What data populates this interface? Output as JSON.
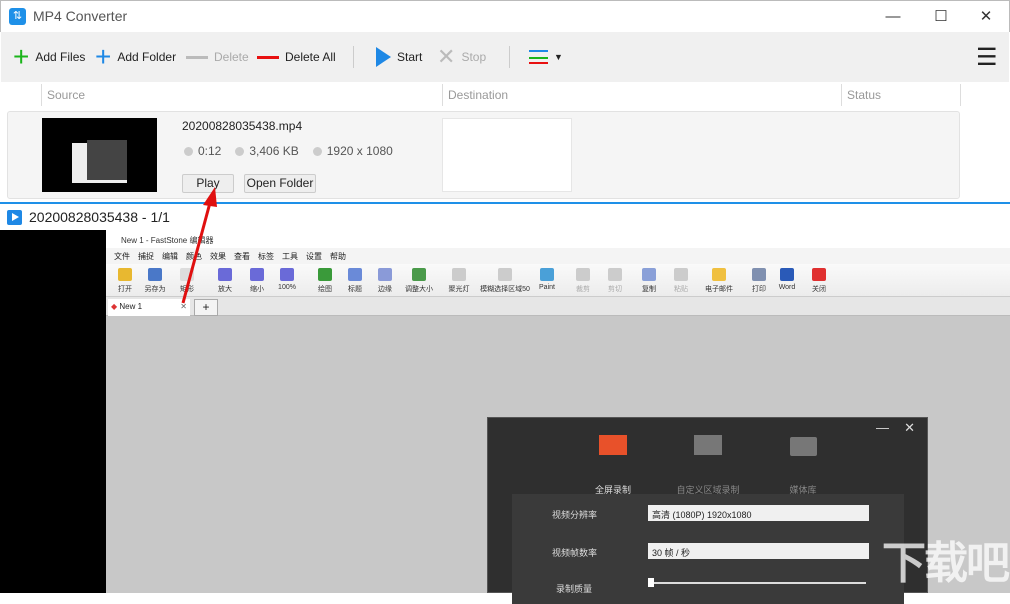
{
  "window": {
    "title": "MP4 Converter",
    "minimize": "—",
    "maximize": "☐",
    "close": "✕"
  },
  "toolbar": {
    "add_files": "Add Files",
    "add_folder": "Add Folder",
    "delete": "Delete",
    "delete_all": "Delete All",
    "start": "Start",
    "stop": "Stop",
    "menu": "☰"
  },
  "columns": {
    "source": "Source",
    "destination": "Destination",
    "status": "Status"
  },
  "file": {
    "name": "20200828035438.mp4",
    "duration": "0:12",
    "size": "3,406 KB",
    "resolution": "1920 x 1080",
    "play": "Play",
    "open_folder": "Open Folder"
  },
  "player": {
    "title": "20200828035438 - 1/1"
  },
  "faststone": {
    "title": "New 1 - FastStone 编辑器",
    "menu": [
      "文件",
      "捕捉",
      "编辑",
      "颜色",
      "效果",
      "查看",
      "标签",
      "工具",
      "设置",
      "帮助"
    ],
    "tools": [
      {
        "label": "打开",
        "color": "#e8b830"
      },
      {
        "label": "另存为",
        "color": "#4a78c8"
      },
      {
        "label": "矩形",
        "color": "#ddd"
      },
      {
        "label": "放大",
        "color": "#6a6ad8"
      },
      {
        "label": "缩小",
        "color": "#6a6ad8"
      },
      {
        "label": "100%",
        "color": "#6a6ad8"
      },
      {
        "label": "绘图",
        "color": "#3a9a3a"
      },
      {
        "label": "标题",
        "color": "#6a8ad8"
      },
      {
        "label": "边缘",
        "color": "#8a9ad8"
      },
      {
        "label": "调整大小",
        "color": "#4a9a4a"
      },
      {
        "label": "聚光灯",
        "color": "#ccc"
      },
      {
        "label": "模糊选择区域50",
        "color": "#ccc"
      },
      {
        "label": "Paint",
        "color": "#4aa0d8"
      },
      {
        "label": "裁剪",
        "color": "#ccc",
        "disabled": true
      },
      {
        "label": "剪切",
        "color": "#ccc",
        "disabled": true
      },
      {
        "label": "复制",
        "color": "#8aa0d8"
      },
      {
        "label": "粘贴",
        "color": "#ccc",
        "disabled": true
      },
      {
        "label": "电子邮件",
        "color": "#f0c040"
      },
      {
        "label": "打印",
        "color": "#8090b0"
      },
      {
        "label": "Word",
        "color": "#2a5ab8"
      },
      {
        "label": "关闭",
        "color": "#e03030"
      }
    ],
    "tab": "New 1",
    "tab_add": "+"
  },
  "recorder": {
    "tabs": [
      "全屏录制",
      "自定义区域录制",
      "媒体库"
    ],
    "resolution_label": "视频分辨率",
    "resolution_value": "高清 (1080P)   1920x1080",
    "fps_label": "视频帧数率",
    "fps_value": "30 帧 / 秒",
    "quality_label": "录制质量",
    "accent": "#e8512a"
  },
  "watermark": "下载吧"
}
